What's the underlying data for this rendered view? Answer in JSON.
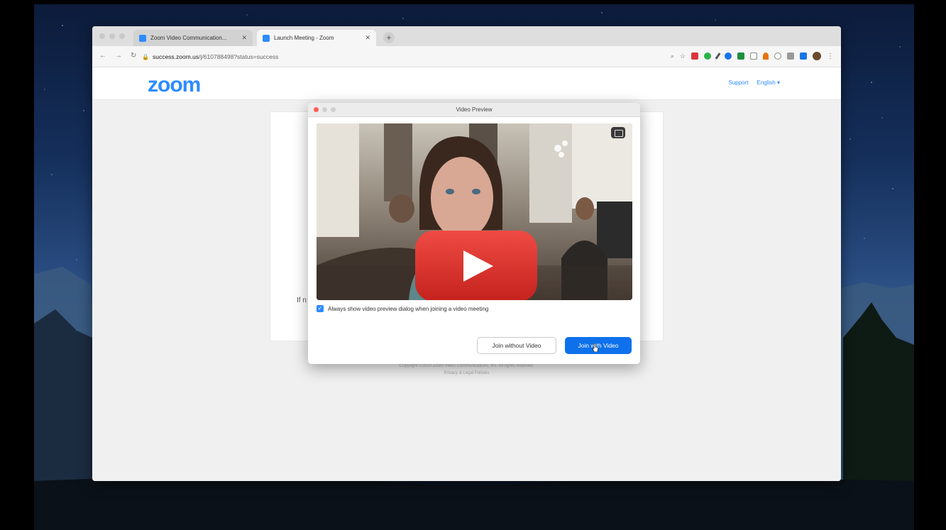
{
  "browser": {
    "tabs": [
      {
        "title": "Zoom Video Communication...",
        "active": false
      },
      {
        "title": "Launch Meeting - Zoom",
        "active": true
      }
    ],
    "url_host": "success.zoom.us",
    "url_path": "/j/610788498?status=success"
  },
  "zoom_page": {
    "logo": "zoom",
    "header_links": [
      "Support",
      "English ▾"
    ],
    "partial_text": "If n",
    "footer_lines": [
      "Copyright ©2020 Zoom Video Communications, Inc. All rights reserved.",
      "Privacy & Legal Policies"
    ]
  },
  "dialog": {
    "title": "Video Preview",
    "checkbox_label": "Always show video preview dialog when joining a video meeting",
    "join_without_video": "Join without Video",
    "join_with_video": "Join with Video"
  },
  "colors": {
    "zoom_blue": "#2d8cff",
    "primary_button": "#0e71eb",
    "play_red": "#e52d27"
  }
}
